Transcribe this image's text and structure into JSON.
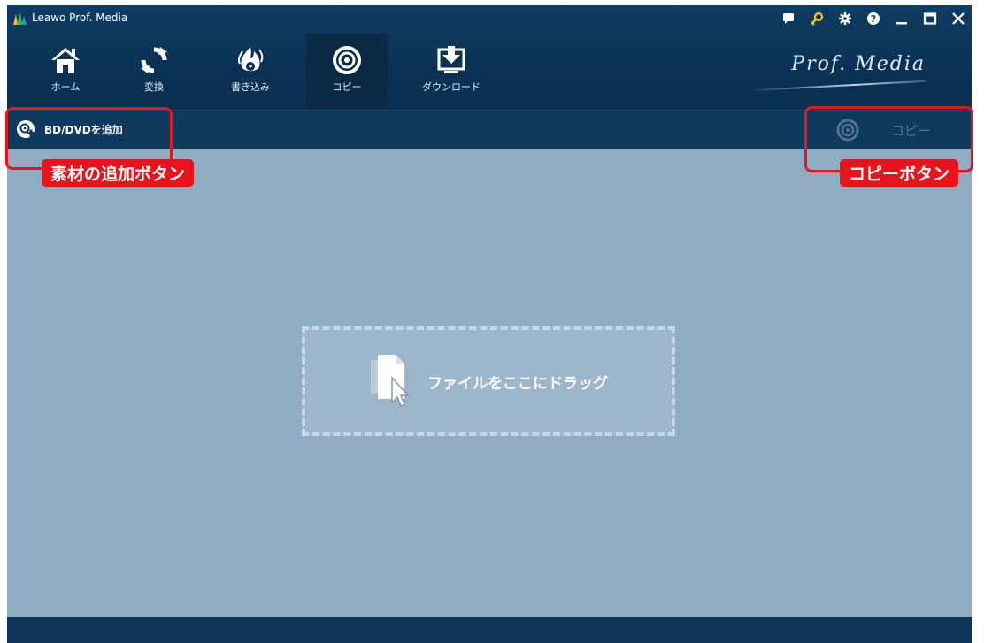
{
  "app": {
    "title": "Leawo Prof. Media",
    "brand": "Prof. Media"
  },
  "window_controls": [
    "chat-icon",
    "key-icon",
    "gear-icon",
    "help-icon",
    "minimize-icon",
    "maximize-icon",
    "close-icon"
  ],
  "nav": [
    {
      "id": "home",
      "label": "ホーム",
      "icon": "home-icon"
    },
    {
      "id": "convert",
      "label": "変換",
      "icon": "convert-icon"
    },
    {
      "id": "burn",
      "label": "書き込み",
      "icon": "burn-icon"
    },
    {
      "id": "copy",
      "label": "コピー",
      "icon": "disc-icon",
      "active": true
    },
    {
      "id": "download",
      "label": "ダウンロード",
      "icon": "download-icon"
    }
  ],
  "toolbar": {
    "add_label": "BD/DVDを追加",
    "copy_label": "コピー"
  },
  "dropzone": {
    "text": "ファイルをここにドラッグ"
  },
  "annotations": {
    "add_button": "素材の追加ボタン",
    "copy_button": "コピーボタン"
  },
  "colors": {
    "accent_red": "#e8141c",
    "nav_bg": "#0b3356",
    "content_bg": "#8facc2"
  }
}
